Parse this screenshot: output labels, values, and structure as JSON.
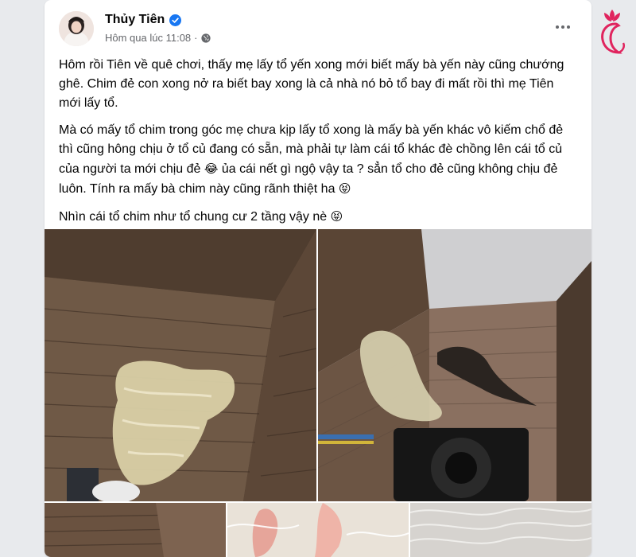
{
  "post": {
    "author": "Thủy Tiên",
    "timestamp": "Hôm qua lúc 11:08",
    "separator": "·",
    "paragraphs": [
      "Hôm rồi Tiên về quê chơi, thấy mẹ lấy tổ yến xong mới biết mấy bà yến này cũng chướng ghê. Chim đẻ con xong nở ra biết bay xong là cả nhà nó bỏ tổ bay đi mất rồi thì mẹ Tiên mới lấy tổ.",
      "Mà có mấy tổ chim trong góc mẹ chưa kịp lấy tổ xong là mấy bà yến khác vô kiếm chổ đẻ thì cũng hông chịu ở tổ củ đang có sẵn, mà phải tự làm cái tổ khác đè chồng lên cái tổ củ của người ta mới chịu đẻ",
      "ủa cái nết gì ngộ vậy ta ? sẳn tổ cho đẻ cũng không chịu đẻ luôn. Tính ra mấy bà chim này cũng rãnh thiệt ha",
      "Nhìn cái tổ chim như tổ chung cư 2 tầng vậy nè"
    ],
    "emoji_1": "😂",
    "emoji_2": "😝",
    "emoji_3": "😝"
  },
  "icons": {
    "verified": "verified-badge-icon",
    "privacy": "globe-icon",
    "more": "more-options-icon",
    "logo": "lotus-woman-logo-icon"
  },
  "colors": {
    "accent": "#1877f2",
    "text": "#050505",
    "muted": "#65676b",
    "logo": "#e0245e"
  }
}
